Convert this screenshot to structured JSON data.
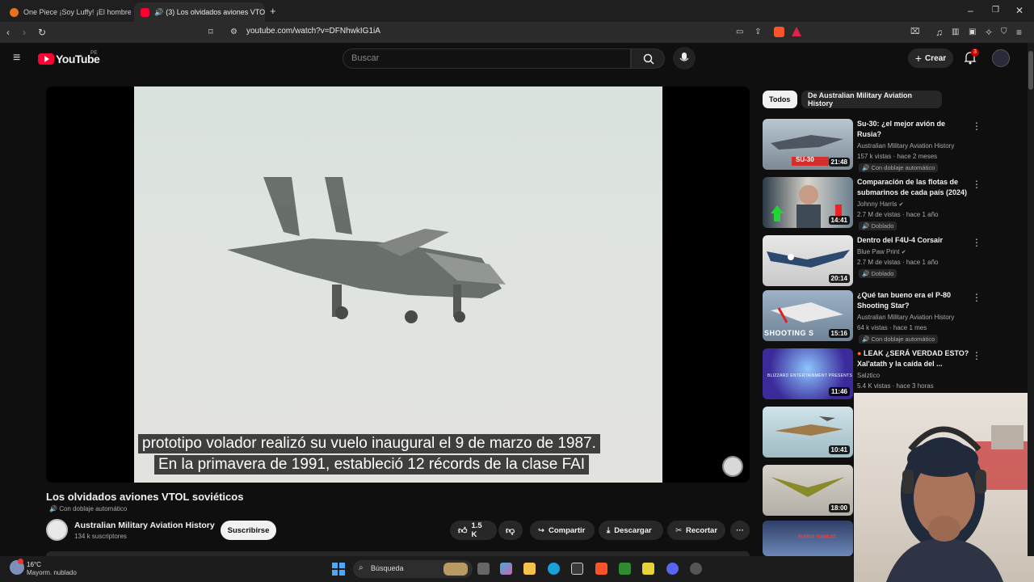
{
  "browser": {
    "tabs": [
      {
        "title": "One Piece ¡Soy Luffy! ¡El hombre que"
      },
      {
        "title": "(3) Los olvidados aviones VTO"
      }
    ],
    "url": "youtube.com/watch?v=DFNhwkIG1iA"
  },
  "youtube": {
    "logo": "YouTube",
    "country": "PE",
    "search_placeholder": "Buscar",
    "create_label": "Crear",
    "notif_count": "3"
  },
  "player": {
    "caption_line1": "prototipo volador realizó su vuelo inaugural el 9 de marzo de 1987.",
    "caption_line2": "En la primavera de 1991, estableció 12 récords de la clase FAI"
  },
  "video": {
    "title": "Los olvidados aviones VTOL soviéticos",
    "dub_label": "Con doblaje automático",
    "channel": "Australian Military Aviation History",
    "subscribers": "134 k suscriptores",
    "subscribe_label": "Suscribirse",
    "likes": "1.5 K",
    "share_label": "Compartir",
    "download_label": "Descargar",
    "clip_label": "Recortar"
  },
  "chips": [
    {
      "label": "Todos"
    },
    {
      "label": "De Australian Military Aviation History"
    }
  ],
  "recommendations": [
    {
      "title": "Su-30: ¿el mejor avión de Rusia?",
      "channel": "Australian Military Aviation History",
      "meta": "157 k vistas · hace 2 meses",
      "badge": "Con doblaje automático",
      "duration": "21:48",
      "thumb_text": "SU-30",
      "verified": false
    },
    {
      "title": "Comparación de las flotas de submarinos de cada país (2024)",
      "channel": "Johnny Harris",
      "meta": "2.7 M de vistas · hace 1 año",
      "badge": "Doblado",
      "duration": "14:41",
      "thumb_text": "",
      "verified": true
    },
    {
      "title": "Dentro del F4U-4 Corsair",
      "channel": "Blue Paw Print",
      "meta": "2.7 M de vistas · hace 1 año",
      "badge": "Doblado",
      "duration": "20:14",
      "thumb_text": "",
      "verified": true
    },
    {
      "title": "¿Qué tan bueno era el P-80 Shooting Star?",
      "channel": "Australian Military Aviation History",
      "meta": "64 k vistas · hace 1 mes",
      "badge": "Con doblaje automático",
      "duration": "15:16",
      "thumb_text": "SHOOTING S",
      "verified": false
    },
    {
      "title": "LEAK ¿SERÁ VERDAD ESTO? Xal'atath y la caída del ...",
      "channel": "Salztico",
      "meta": "5.4 K vistas · hace 3 horas",
      "badge": "",
      "duration": "11:46",
      "thumb_text": "BLIZZARD ENTERTAINMENT PRESENTS",
      "verified": false
    },
    {
      "title": "",
      "channel": "",
      "meta": "",
      "badge": "",
      "duration": "10:41",
      "thumb_text": "",
      "verified": false
    },
    {
      "title": "",
      "channel": "",
      "meta": "",
      "badge": "",
      "duration": "18:00",
      "thumb_text": "",
      "verified": false
    },
    {
      "title": "",
      "channel": "",
      "meta": "",
      "badge": "",
      "duration": "",
      "thumb_text": "SUPER TOMCAT",
      "verified": false
    }
  ],
  "taskbar": {
    "weather_temp": "16°C",
    "weather_desc": "Mayorm. nublado",
    "search_label": "Búsqueda"
  },
  "colors": {
    "youtube_red": "#ff0033",
    "bg": "#0f0f0f",
    "chip_active": "#f1f1f1"
  }
}
